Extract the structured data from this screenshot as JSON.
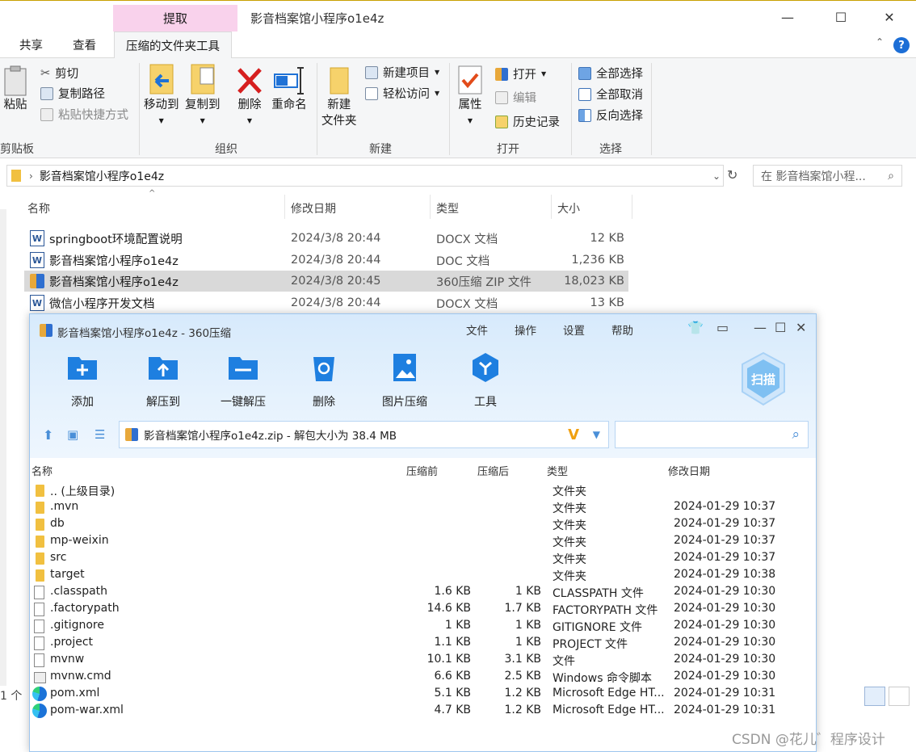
{
  "explorer": {
    "context_tab": "提取",
    "title": "影音档案馆小程序o1e4z",
    "tabs": [
      "共享",
      "查看",
      "压缩的文件夹工具"
    ],
    "help": "?",
    "ribbon": {
      "clipboard": {
        "paste": "粘贴",
        "cut": "剪切",
        "copy_path": "复制路径",
        "paste_shortcut": "粘贴快捷方式",
        "label": "剪贴板"
      },
      "organize": {
        "move_to": "移动到",
        "copy_to": "复制到",
        "delete": "删除",
        "rename": "重命名",
        "label": "组织"
      },
      "new": {
        "new_folder_1": "新建",
        "new_folder_2": "文件夹",
        "new_item": "新建项目",
        "easy_access": "轻松访问",
        "label": "新建"
      },
      "open": {
        "properties": "属性",
        "open": "打开",
        "edit": "编辑",
        "history": "历史记录",
        "label": "打开"
      },
      "select": {
        "select_all": "全部选择",
        "select_none": "全部取消",
        "invert": "反向选择",
        "label": "选择"
      }
    },
    "address": "影音档案馆小程序o1e4z",
    "search_placeholder": "在 影音档案馆小程...",
    "columns": {
      "name": "名称",
      "date": "修改日期",
      "type": "类型",
      "size": "大小"
    },
    "files": [
      {
        "name": "springboot环境配置说明",
        "date": "2024/3/8 20:44",
        "type": "DOCX 文档",
        "size": "12 KB",
        "icon": "word-icon"
      },
      {
        "name": "影音档案馆小程序o1e4z",
        "date": "2024/3/8 20:44",
        "type": "DOC 文档",
        "size": "1,236 KB",
        "icon": "word-icon"
      },
      {
        "name": "影音档案馆小程序o1e4z",
        "date": "2024/3/8 20:45",
        "type": "360压缩 ZIP 文件",
        "size": "18,023 KB",
        "icon": "zip-icon"
      },
      {
        "name": "微信小程序开发文档",
        "date": "2024/3/8 20:44",
        "type": "DOCX 文档",
        "size": "13 KB",
        "icon": "word-icon"
      }
    ],
    "status": "1 个"
  },
  "zip": {
    "title": "影音档案馆小程序o1e4z - 360压缩",
    "menu": [
      "文件",
      "操作",
      "设置",
      "帮助"
    ],
    "tools": [
      "添加",
      "解压到",
      "一键解压",
      "删除",
      "图片压缩",
      "工具"
    ],
    "scan": "扫描",
    "path": "影音档案馆小程序o1e4z.zip - 解包大小为 38.4 MB",
    "columns": {
      "name": "名称",
      "pre": "压缩前",
      "post": "压缩后",
      "type": "类型",
      "date": "修改日期"
    },
    "rows": [
      {
        "name": ".. (上级目录)",
        "pre": "",
        "post": "",
        "type": "文件夹",
        "date": "",
        "icon": "folder"
      },
      {
        "name": ".mvn",
        "pre": "",
        "post": "",
        "type": "文件夹",
        "date": "2024-01-29 10:37",
        "icon": "folder"
      },
      {
        "name": "db",
        "pre": "",
        "post": "",
        "type": "文件夹",
        "date": "2024-01-29 10:37",
        "icon": "folder"
      },
      {
        "name": "mp-weixin",
        "pre": "",
        "post": "",
        "type": "文件夹",
        "date": "2024-01-29 10:37",
        "icon": "folder"
      },
      {
        "name": "src",
        "pre": "",
        "post": "",
        "type": "文件夹",
        "date": "2024-01-29 10:37",
        "icon": "folder"
      },
      {
        "name": "target",
        "pre": "",
        "post": "",
        "type": "文件夹",
        "date": "2024-01-29 10:38",
        "icon": "folder"
      },
      {
        "name": ".classpath",
        "pre": "1.6 KB",
        "post": "1 KB",
        "type": "CLASSPATH 文件",
        "date": "2024-01-29 10:30",
        "icon": "file"
      },
      {
        "name": ".factorypath",
        "pre": "14.6 KB",
        "post": "1.7 KB",
        "type": "FACTORYPATH 文件",
        "date": "2024-01-29 10:30",
        "icon": "file"
      },
      {
        "name": ".gitignore",
        "pre": "1 KB",
        "post": "1 KB",
        "type": "GITIGNORE 文件",
        "date": "2024-01-29 10:30",
        "icon": "file"
      },
      {
        "name": ".project",
        "pre": "1.1 KB",
        "post": "1 KB",
        "type": "PROJECT 文件",
        "date": "2024-01-29 10:30",
        "icon": "file"
      },
      {
        "name": "mvnw",
        "pre": "10.1 KB",
        "post": "3.1 KB",
        "type": "文件",
        "date": "2024-01-29 10:30",
        "icon": "file"
      },
      {
        "name": "mvnw.cmd",
        "pre": "6.6 KB",
        "post": "2.5 KB",
        "type": "Windows 命令脚本",
        "date": "2024-01-29 10:30",
        "icon": "cmd"
      },
      {
        "name": "pom.xml",
        "pre": "5.1 KB",
        "post": "1.2 KB",
        "type": "Microsoft Edge HT...",
        "date": "2024-01-29 10:31",
        "icon": "edge"
      },
      {
        "name": "pom-war.xml",
        "pre": "4.7 KB",
        "post": "1.2 KB",
        "type": "Microsoft Edge HT...",
        "date": "2024-01-29 10:31",
        "icon": "edge"
      }
    ]
  },
  "watermark": "CSDN @花儿゛程序设计"
}
